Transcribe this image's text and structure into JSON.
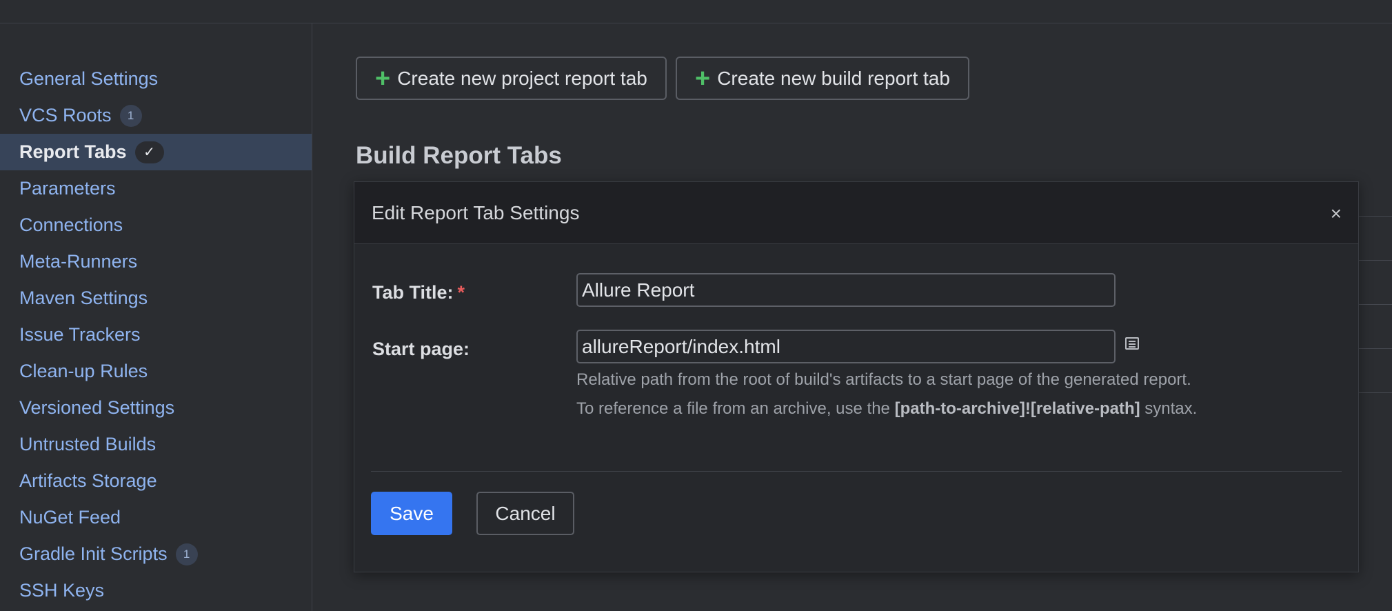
{
  "sidebar": {
    "items": [
      {
        "label": "General Settings"
      },
      {
        "label": "VCS Roots",
        "badge": "1"
      },
      {
        "label": "Report Tabs",
        "badge": "✓"
      },
      {
        "label": "Parameters"
      },
      {
        "label": "Connections"
      },
      {
        "label": "Meta-Runners"
      },
      {
        "label": "Maven Settings"
      },
      {
        "label": "Issue Trackers"
      },
      {
        "label": "Clean-up Rules"
      },
      {
        "label": "Versioned Settings"
      },
      {
        "label": "Untrusted Builds"
      },
      {
        "label": "Artifacts Storage"
      },
      {
        "label": "NuGet Feed"
      },
      {
        "label": "Gradle Init Scripts",
        "badge": "1"
      },
      {
        "label": "SSH Keys"
      }
    ]
  },
  "toolbar": {
    "create_project_tab": "Create new project report tab",
    "create_build_tab": "Create new build report tab"
  },
  "main": {
    "section_title": "Build Report Tabs"
  },
  "dialog": {
    "title": "Edit Report Tab Settings",
    "close_glyph": "×",
    "tab_title_label": "Tab Title:",
    "required_mark": "*",
    "tab_title_value": "Allure Report",
    "start_page_label": "Start page:",
    "start_page_value": "allureReport/index.html",
    "help_line1": "Relative path from the root of build's artifacts to a start page of the generated report.",
    "help_line2_prefix": "To reference a file from an archive, use the ",
    "help_line2_bold": "[path-to-archive]![relative-path]",
    "help_line2_suffix": " syntax.",
    "save_label": "Save",
    "cancel_label": "Cancel"
  },
  "colors": {
    "accent": "#3575f0",
    "plus": "#4fbf67",
    "required": "#e85c5c",
    "link": "#8fb4f0"
  }
}
